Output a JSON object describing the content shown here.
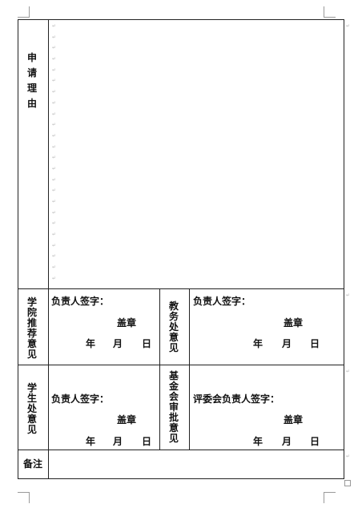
{
  "form": {
    "reason_label": [
      "申",
      "请",
      "理",
      "由"
    ],
    "college_label": [
      "学",
      "院",
      "推",
      "荐",
      "意",
      "见"
    ],
    "academic_label": [
      "教",
      "务",
      "处",
      "意",
      "见"
    ],
    "student_label": [
      "学",
      "生",
      "处",
      "意",
      "见"
    ],
    "foundation_label": [
      "基",
      "金",
      "会",
      "审",
      "批",
      "意",
      "见"
    ],
    "remark_label": "备注",
    "signer": "负责人签字：",
    "committee_signer": "评委会负责人签字：",
    "seal": "盖章",
    "year": "年",
    "month": "月",
    "day": "日"
  }
}
